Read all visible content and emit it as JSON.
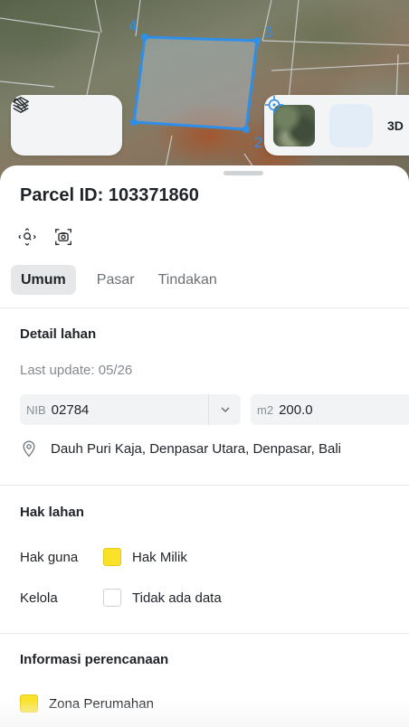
{
  "map": {
    "vertices": [
      "4",
      "3",
      "2"
    ],
    "parcel_color": "#2f8fe8",
    "controls_left": [
      {
        "icon": "layers-icon"
      },
      {
        "icon": "measure-link-icon"
      }
    ],
    "controls_right": {
      "basemap_icon": "satellite-thumbnail",
      "locate_icon": "crosshair-icon",
      "three_d_label": "3D"
    }
  },
  "sheet": {
    "title": "Parcel ID: 103371860",
    "quick_actions": [
      {
        "icon": "zoom-to-parcel-icon"
      },
      {
        "icon": "screenshot-icon"
      }
    ],
    "tabs": [
      {
        "label": "Umum",
        "active": true
      },
      {
        "label": "Pasar",
        "active": false
      },
      {
        "label": "Tindakan",
        "active": false
      }
    ],
    "detail": {
      "heading": "Detail lahan",
      "last_update": "Last update: 05/26",
      "nib_prefix": "NIB",
      "nib_value": "02784",
      "area_prefix": "m2",
      "area_value": "200.0",
      "address": "Dauh Puri Kaja, Denpasar Utara, Denpasar, Bali"
    },
    "rights": {
      "heading": "Hak lahan",
      "rows": [
        {
          "key": "Hak guna",
          "value": "Hak Milik",
          "swatch": "#fae22a"
        },
        {
          "key": "Kelola",
          "value": "Tidak ada data",
          "swatch": "none"
        }
      ]
    },
    "planning": {
      "heading": "Informasi perencanaan",
      "zones": [
        {
          "label": "Zona Perumahan",
          "color": "#fae22a"
        }
      ]
    }
  }
}
